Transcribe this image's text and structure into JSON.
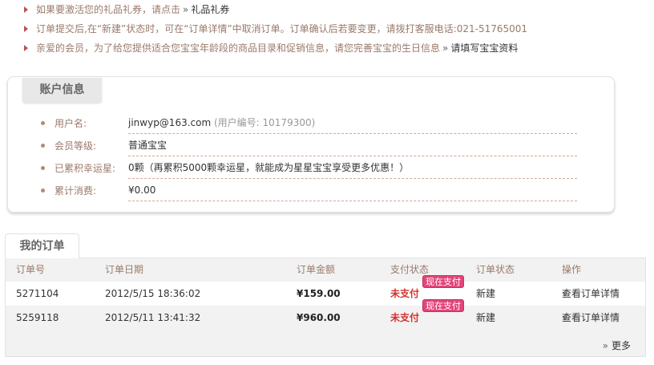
{
  "notices": [
    {
      "text": "如果要激活您的礼品礼券，请点击",
      "link": "礼品礼券"
    },
    {
      "text": "订单提交后,在“新建”状态时，可在“订单详情”中取消订单。订单确认后若要变更，请拨打客服电话:021-51765001",
      "link": ""
    },
    {
      "text": "亲爱的会员，为了给您提供适合您宝宝年龄段的商品目录和促销信息，请您完善宝宝的生日信息",
      "link": "请填写宝宝资料"
    }
  ],
  "account": {
    "title": "账户信息",
    "rows": [
      {
        "label": "用户名:",
        "value": "jinwyp@163.com",
        "sub": "(用户编号: 10179300)"
      },
      {
        "label": "会员等级:",
        "value": "普通宝宝",
        "sub": ""
      },
      {
        "label": "已累积幸运星:",
        "value": "0颗（再累积5000颗幸运星，就能成为星星宝宝享受更多优惠！）",
        "sub": ""
      },
      {
        "label": "累计消费:",
        "value": "¥0.00",
        "sub": ""
      }
    ]
  },
  "orders": {
    "title": "我的订单",
    "columns": [
      "订单号",
      "订单日期",
      "订单金额",
      "支付状态",
      "订单状态",
      "操作"
    ],
    "rows": [
      {
        "id": "5271104",
        "date": "2012/5/15 18:36:02",
        "amount": "¥159.00",
        "pay_status": "未支付",
        "pay_now": "现在支付",
        "status": "新建",
        "action": "查看订单详情"
      },
      {
        "id": "5259118",
        "date": "2012/5/11 13:41:32",
        "amount": "¥960.00",
        "pay_status": "未支付",
        "pay_now": "现在支付",
        "status": "新建",
        "action": "查看订单详情"
      }
    ],
    "more": "更多"
  },
  "colors": {
    "accent": "#c0504d",
    "label": "#9a7a6a",
    "unpaid": "#d2322d",
    "badge": "#e2457a"
  }
}
